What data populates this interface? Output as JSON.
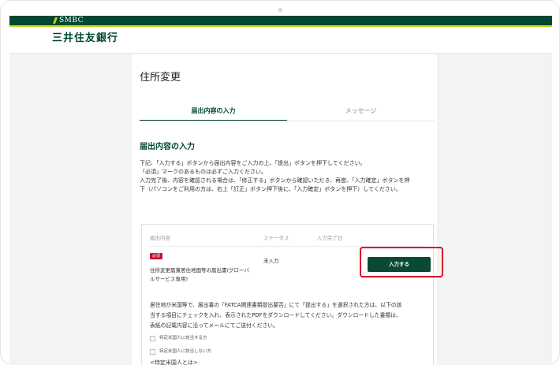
{
  "brand": {
    "logo_text": "SMBC",
    "bank_name": "三井住友銀行"
  },
  "page": {
    "title": "住所変更"
  },
  "tabs": [
    {
      "label": "届出内容の入力",
      "active": true
    },
    {
      "label": "メッセージ",
      "active": false
    }
  ],
  "section": {
    "title": "届出内容の入力",
    "description": [
      "下記、「入力する」ボタンから届出内容をご入力の上、「提出」ボタンを押下してください。",
      "「必須」マークのあるものは必ずご入力ください。",
      "入力完了後、内容を確認される場合は、「修正する」ボタンから確認いただき、再度、「入力確定」ボタンを押",
      "下（パソコンをご利用の方は、右上「訂正」ボタン押下後に、「入力確定」ボタンを押下）してください。"
    ]
  },
  "table": {
    "headers": [
      "届出内容",
      "ステータス",
      "入力完了日"
    ],
    "rows": [
      {
        "required_badge": "必須",
        "name_lines": [
          "住所変更届兼居住地国等の届出書(グローバ",
          "ルサービス専用)"
        ],
        "status": "未入力",
        "completed_date": "",
        "action_label": "入力する"
      }
    ]
  },
  "fatca": {
    "note": [
      "居住地が米国等で、届出書の「FATCA関連書類提出要否」にて「提出する」を選択された方は、以下の該",
      "当する項目にチェックを入れ、表示されたPDFをダウンロードしてください。ダウンロードした書類は、",
      "表紙の記載内容に沿ってメールにてご送付ください。"
    ],
    "options": [
      {
        "label": "特定米国人に該当する方",
        "checked": false
      },
      {
        "label": "特定米国人に該当しない方",
        "checked": false
      }
    ],
    "subheading": "<特定米国人とは>"
  },
  "colors": {
    "brand_green": "#004831",
    "accent_lime": "#c2d400",
    "required_red": "#c8102e",
    "highlight_red": "#d20f2a"
  }
}
